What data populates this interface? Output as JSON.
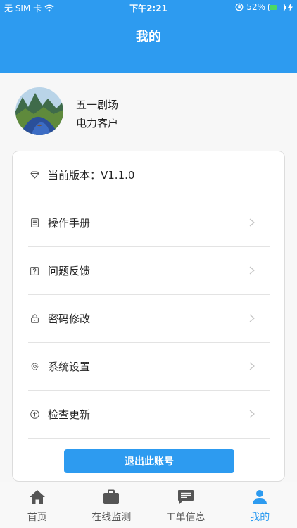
{
  "status_bar": {
    "carrier": "无 SIM 卡",
    "time": "下午2:21",
    "battery": "52%",
    "battery_level": 0.52
  },
  "header": {
    "title": "我的"
  },
  "profile": {
    "name": "五一剧场",
    "role": "电力客户"
  },
  "menu": [
    {
      "label": "当前版本：V1.1.0",
      "icon": "diamond-icon",
      "arrow": false
    },
    {
      "label": "操作手册",
      "icon": "document-icon",
      "arrow": true
    },
    {
      "label": "问题反馈",
      "icon": "question-icon",
      "arrow": true
    },
    {
      "label": "密码修改",
      "icon": "lock-icon",
      "arrow": true
    },
    {
      "label": "系统设置",
      "icon": "gear-icon",
      "arrow": true
    },
    {
      "label": "检查更新",
      "icon": "upload-icon",
      "arrow": true
    }
  ],
  "logout_label": "退出此账号",
  "tabs": [
    {
      "label": "首页",
      "icon": "home-icon"
    },
    {
      "label": "在线监测",
      "icon": "briefcase-icon"
    },
    {
      "label": "工单信息",
      "icon": "message-icon"
    },
    {
      "label": "我的",
      "icon": "person-icon",
      "active": true
    }
  ],
  "colors": {
    "brand": "#2d9bf0",
    "battery": "#4cd964"
  }
}
